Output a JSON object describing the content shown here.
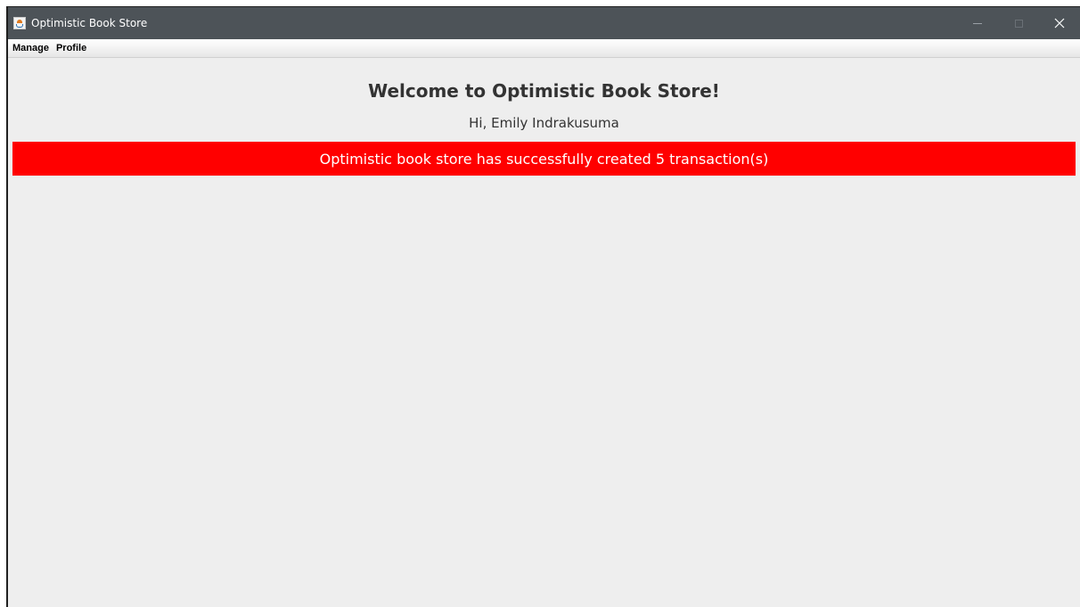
{
  "window": {
    "title": "Optimistic Book Store",
    "title_bar_color": "#4d5358",
    "icon": "java-cup-icon",
    "controls": [
      "minimize-icon",
      "maximize-icon",
      "close-icon"
    ]
  },
  "menubar": {
    "items": [
      {
        "label": "Manage"
      },
      {
        "label": "Profile"
      }
    ]
  },
  "main": {
    "welcome_title": "Welcome to Optimistic Book Store!",
    "greeting": "Hi, Emily Indrakusuma",
    "banner": {
      "text": "Optimistic book store has successfully created 5 transaction(s)",
      "background": "#ff0000",
      "text_color": "#ffffff"
    },
    "background": "#eeeeee"
  }
}
